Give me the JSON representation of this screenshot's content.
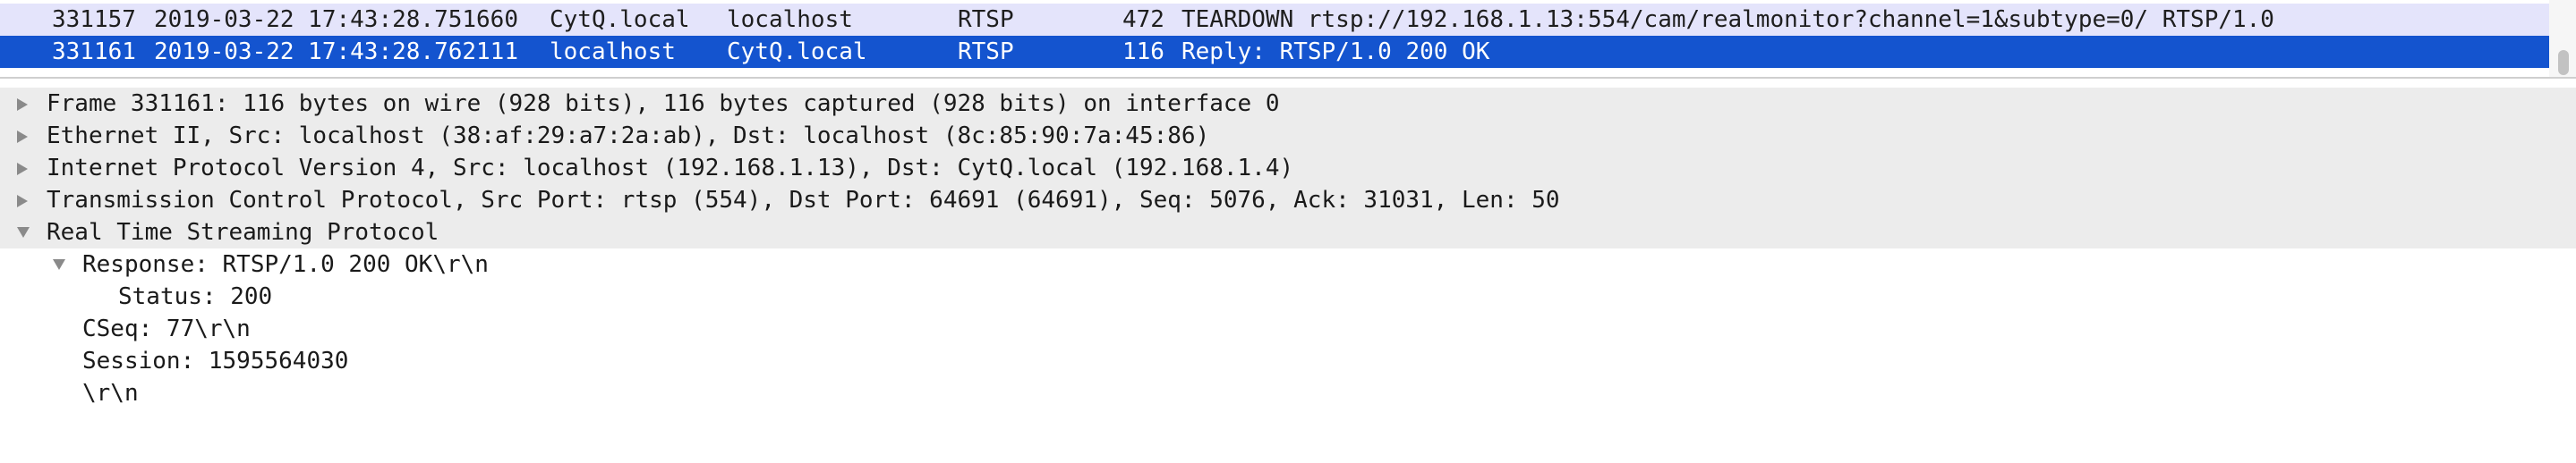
{
  "packet_list": {
    "rows": [
      {
        "no": "331157",
        "time": "2019-03-22 17:43:28.751660",
        "source": "CytQ.local",
        "destination": "localhost",
        "protocol": "RTSP",
        "length": "472",
        "info": "TEARDOWN rtsp://192.168.1.13:554/cam/realmonitor?channel=1&subtype=0/ RTSP/1.0",
        "selected": false
      },
      {
        "no": "331161",
        "time": "2019-03-22 17:43:28.762111",
        "source": "localhost",
        "destination": "CytQ.local",
        "protocol": "RTSP",
        "length": "116",
        "info": "Reply: RTSP/1.0 200 OK",
        "selected": true
      }
    ]
  },
  "details": {
    "frame": "Frame 331161: 116 bytes on wire (928 bits), 116 bytes captured (928 bits) on interface 0",
    "ethernet": "Ethernet II, Src: localhost (38:af:29:a7:2a:ab), Dst: localhost (8c:85:90:7a:45:86)",
    "ip": "Internet Protocol Version 4, Src: localhost (192.168.1.13), Dst: CytQ.local (192.168.1.4)",
    "tcp": "Transmission Control Protocol, Src Port: rtsp (554), Dst Port: 64691 (64691), Seq: 5076, Ack: 31031, Len: 50",
    "rtsp": "Real Time Streaming Protocol",
    "response": "Response: RTSP/1.0 200 OK\\r\\n",
    "status": "Status: 200",
    "cseq": "CSeq: 77\\r\\n",
    "session": "Session: 1595564030",
    "crlf": "\\r\\n"
  },
  "colors": {
    "selected_row": "#1454cf",
    "teardown_row": "#e4e4fb",
    "shaded_tree_row": "#ececec"
  },
  "icons": {
    "collapsed": "triangle-right-icon",
    "expanded": "triangle-down-icon"
  }
}
